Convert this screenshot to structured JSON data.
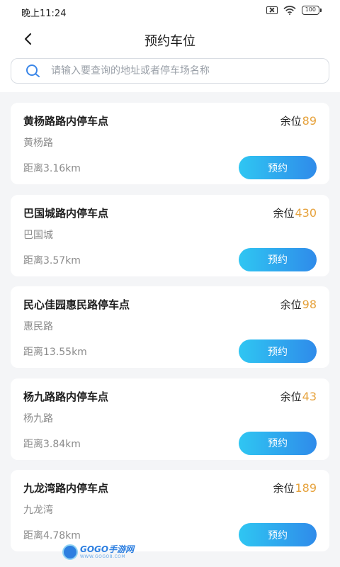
{
  "status_bar": {
    "time": "晚上11:24",
    "battery": "100"
  },
  "header": {
    "title": "预约车位",
    "back_icon": "chevron-left-icon"
  },
  "search": {
    "placeholder": "请输入要查询的地址或者停车场名称",
    "value": "",
    "icon": "search-icon"
  },
  "colors": {
    "accent_start": "#2fc6f2",
    "accent_end": "#2f8bea",
    "count": "#e6a23c"
  },
  "parking_list": [
    {
      "name": "黄杨路路内停车点",
      "street": "黄杨路",
      "distance": "距离3.16km",
      "remain_label": "余位",
      "remain_count": "89",
      "action": "预约"
    },
    {
      "name": "巴国城路内停车点",
      "street": "巴国城",
      "distance": "距离3.57km",
      "remain_label": "余位",
      "remain_count": "430",
      "action": "预约"
    },
    {
      "name": "民心佳园惠民路停车点",
      "street": "惠民路",
      "distance": "距离13.55km",
      "remain_label": "余位",
      "remain_count": "98",
      "action": "预约"
    },
    {
      "name": "杨九路路内停车点",
      "street": "杨九路",
      "distance": "距离3.84km",
      "remain_label": "余位",
      "remain_count": "43",
      "action": "预约"
    },
    {
      "name": "九龙湾路内停车点",
      "street": "九龙湾",
      "distance": "距离4.78km",
      "remain_label": "余位",
      "remain_count": "189",
      "action": "预约"
    }
  ],
  "watermark": {
    "text": "GOGO手游网",
    "url": "WWW.GOGO8.COM"
  }
}
